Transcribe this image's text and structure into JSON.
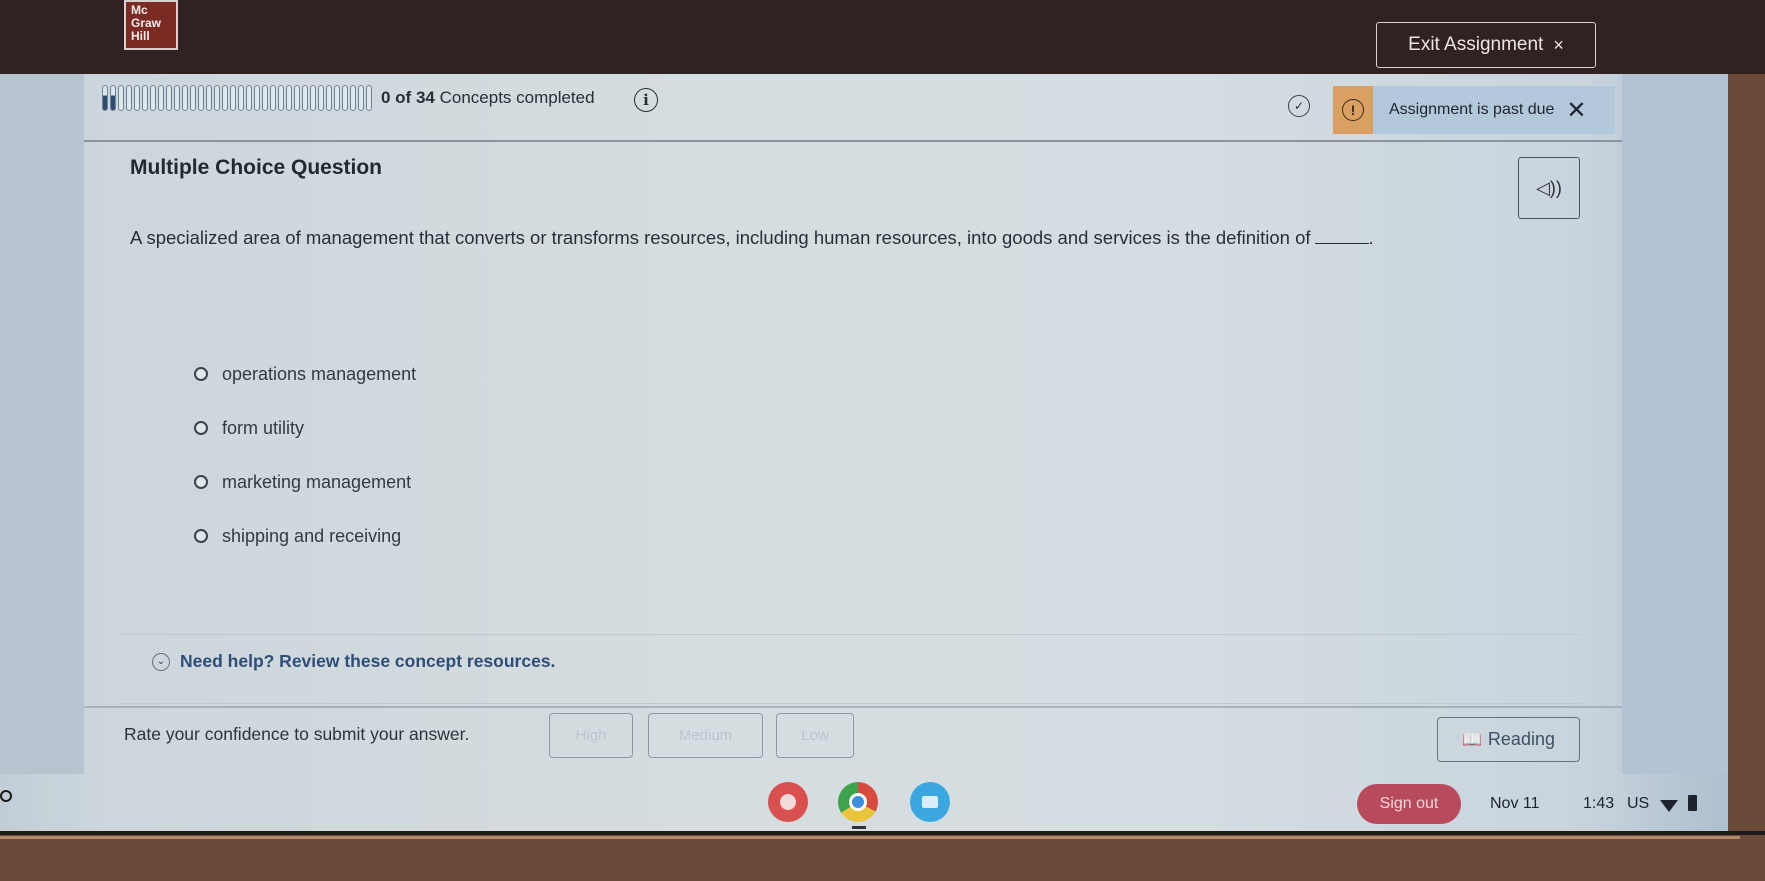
{
  "header": {
    "logo_lines": [
      "Mc",
      "Graw",
      "Hill"
    ],
    "exit_label": "Exit Assignment",
    "exit_icon": "close-icon"
  },
  "progress": {
    "completed": 0,
    "total": 34,
    "count_text": "0 of 34",
    "label": "Concepts completed",
    "info_icon": "info-icon"
  },
  "alert": {
    "message": "Assignment is past due",
    "icon": "exclamation-icon",
    "close_glyph": "✕"
  },
  "question": {
    "type_label": "Multiple Choice Question",
    "text": "A specialized area of management that converts or transforms resources, including human resources, into goods and services is the definition of",
    "trailing": ".",
    "audio_icon": "speaker-icon",
    "options": [
      {
        "label": "operations management",
        "selected": false
      },
      {
        "label": "form utility",
        "selected": false
      },
      {
        "label": "marketing management",
        "selected": false
      },
      {
        "label": "shipping and receiving",
        "selected": false
      }
    ]
  },
  "help": {
    "label": "Need help? Review these concept resources."
  },
  "confidence": {
    "prompt": "Rate your confidence to submit your answer.",
    "buttons": [
      "High",
      "Medium",
      "Low"
    ]
  },
  "reading": {
    "label": "Reading",
    "icon": "book-icon"
  },
  "taskbar": {
    "apps": [
      "chat-app",
      "chrome",
      "classroom-app"
    ],
    "signout_label": "Sign out",
    "date": "Nov 11",
    "time": "1:43",
    "ime": "US"
  }
}
